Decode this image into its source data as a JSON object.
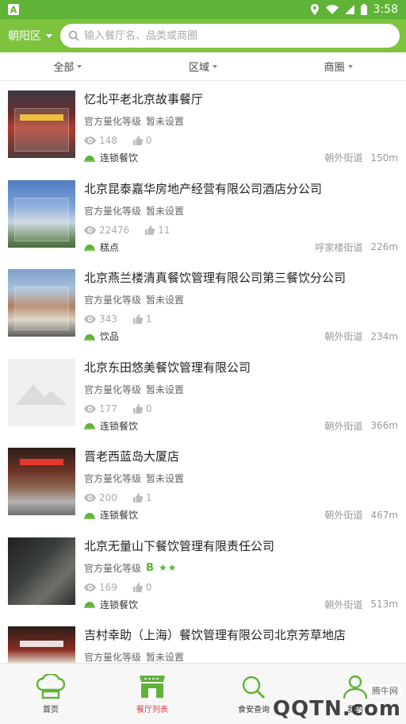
{
  "status_bar": {
    "left_badge": "A",
    "time": "3:58"
  },
  "header": {
    "district": "朝阳区",
    "search_placeholder": "输入餐厅名、品类或商圈"
  },
  "filters": [
    {
      "label": "全部"
    },
    {
      "label": "区域"
    },
    {
      "label": "商圈"
    }
  ],
  "restaurants": [
    {
      "name": "忆北平老北京故事餐厅",
      "grade_label": "官方量化等级",
      "grade_value": "暂未设置",
      "views": "148",
      "likes": "0",
      "category": "连锁餐饮",
      "street": "朝外街道",
      "distance": "150m"
    },
    {
      "name": "北京昆泰嘉华房地产经营有限公司酒店分公司",
      "grade_label": "官方量化等级",
      "grade_value": "暂未设置",
      "views": "22476",
      "likes": "11",
      "category": "糕点",
      "street": "呼家楼街道",
      "distance": "226m"
    },
    {
      "name": "北京燕兰楼清真餐饮管理有限公司第三餐饮分公司",
      "grade_label": "官方量化等级",
      "grade_value": "暂未设置",
      "views": "343",
      "likes": "1",
      "category": "饮品",
      "street": "朝外街道",
      "distance": "234m"
    },
    {
      "name": "北京东田悠美餐饮管理有限公司",
      "grade_label": "官方量化等级",
      "grade_value": "暂未设置",
      "views": "177",
      "likes": "0",
      "category": "连锁餐饮",
      "street": "朝外街道",
      "distance": "366m"
    },
    {
      "name": "晋老西蓝岛大厦店",
      "grade_label": "官方量化等级",
      "grade_value": "暂未设置",
      "views": "200",
      "likes": "1",
      "category": "连锁餐饮",
      "street": "朝外街道",
      "distance": "467m"
    },
    {
      "name": "北京无量山下餐饮管理有限责任公司",
      "grade_label": "官方量化等级",
      "grade_value": "B",
      "grade_stars": "★★",
      "views": "169",
      "likes": "0",
      "category": "连锁餐饮",
      "street": "朝外街道",
      "distance": "513m"
    },
    {
      "name": "吉村幸助（上海）餐饮管理有限公司北京芳草地店",
      "grade_label": "官方量化等级",
      "grade_value": "暂未设置",
      "views": "",
      "likes": "",
      "category": "",
      "street": "",
      "distance": ""
    }
  ],
  "tabs": [
    {
      "label": "首页",
      "icon": "chef-hat-icon"
    },
    {
      "label": "餐厅列表",
      "icon": "storefront-icon"
    },
    {
      "label": "食安查询",
      "icon": "search-icon"
    },
    {
      "label": "我的",
      "icon": "user-icon"
    }
  ],
  "watermark": {
    "top": "腾牛网",
    "main": "QQTN.com"
  },
  "colors": {
    "status_bar": "#5fb336",
    "header": "#7ec33e",
    "accent_green": "#5fb336",
    "active_tab_red": "#e4393c"
  }
}
